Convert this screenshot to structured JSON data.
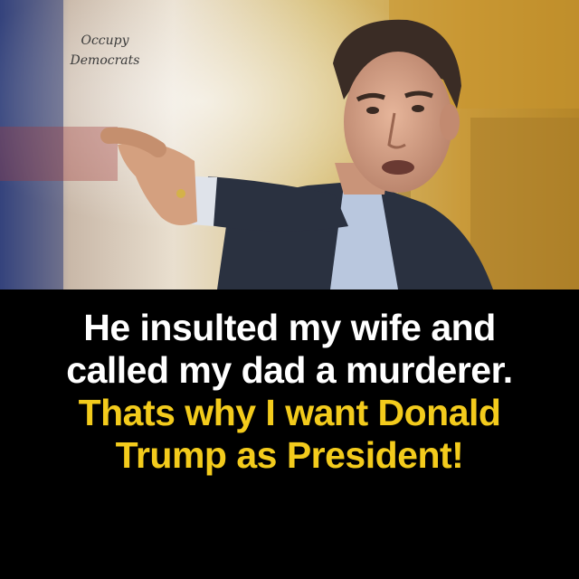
{
  "watermark": {
    "line1": "Occupy",
    "line2": "Democrats"
  },
  "caption": {
    "white_lines": [
      "He insulted my wife and",
      "called my dad a murderer."
    ],
    "yellow_lines": [
      "Thats why I want Donald",
      "Trump as President!"
    ]
  },
  "colors": {
    "caption_background": "#000000",
    "white_text": "#ffffff",
    "yellow_text": "#f3cb1c"
  }
}
